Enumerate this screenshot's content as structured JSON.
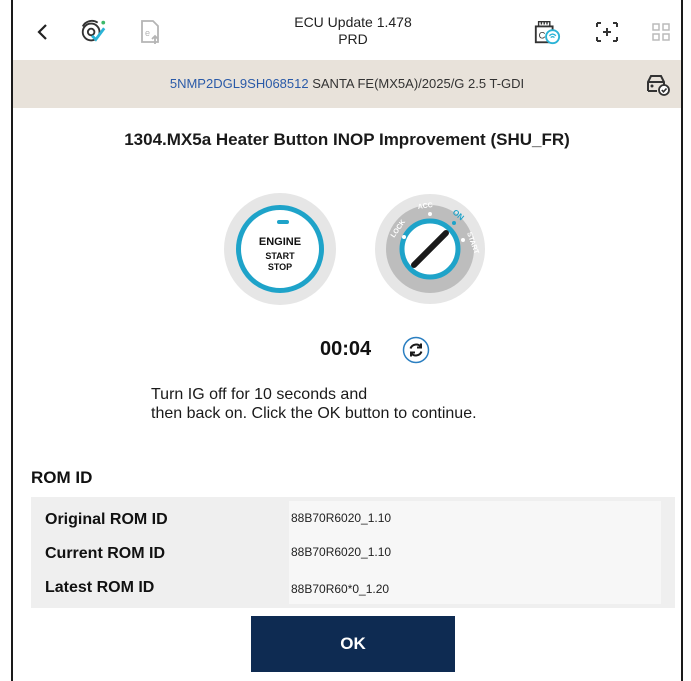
{
  "header": {
    "title": "ECU Update 1.478",
    "subtitle": "PRD",
    "icons": [
      "back-icon",
      "diagnostic-check-icon",
      "document-upload-icon",
      "vci-wifi-icon",
      "expand-icon",
      "grid-icon"
    ]
  },
  "vehicle": {
    "vin": "5NMP2DGL9SH068512",
    "description": "SANTA FE(MX5A)/2025/G 2.5 T-GDI",
    "icon": "vehicle-check-icon"
  },
  "procedure": {
    "title": "1304.MX5a Heater Button INOP Improvement (SHU_FR)",
    "engine_button": {
      "line1": "ENGINE",
      "line2": "START",
      "line3": "STOP"
    },
    "ignition": {
      "positions": [
        "LOCK",
        "ACC",
        "ON",
        "START"
      ],
      "active": "ON"
    },
    "timer": "00:04",
    "instruction_line1": "Turn IG off for 10 seconds and",
    "instruction_line2": "then back on. Click the OK button to continue."
  },
  "rom": {
    "heading": "ROM ID",
    "rows": [
      {
        "label": "Original ROM ID",
        "value": "88B70R6020_1.10"
      },
      {
        "label": "Current ROM ID",
        "value": "88B70R6020_1.10"
      },
      {
        "label": "Latest ROM ID",
        "value": "88B70R60*0_1.20"
      }
    ]
  },
  "actions": {
    "ok_label": "OK"
  },
  "colors": {
    "accent": "#1ea3c9",
    "primary_button": "#0e2b52",
    "vehicle_bar": "#e8e2da",
    "vin_text": "#2a5aa8"
  }
}
